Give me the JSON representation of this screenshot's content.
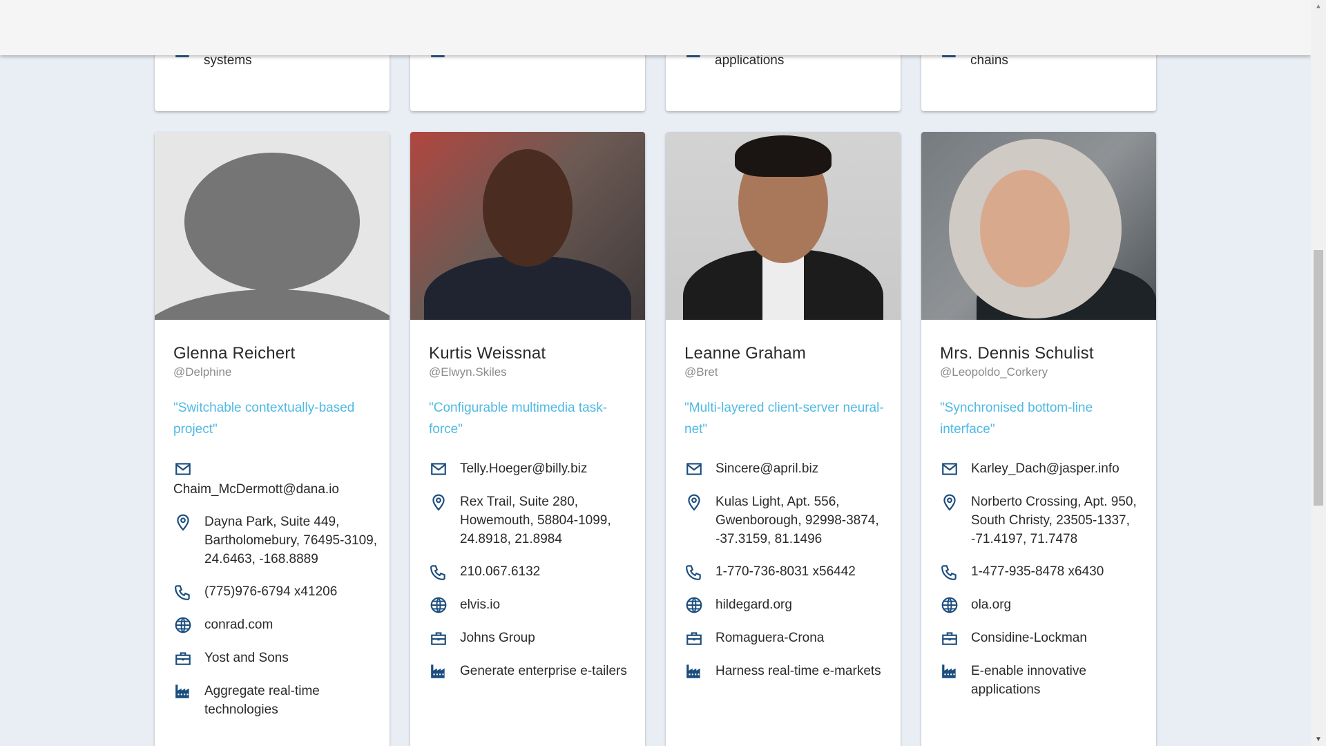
{
  "colors": {
    "accent_quote": "#4fb9e3",
    "icon": "#1b4d7e",
    "background": "#e9eef5"
  },
  "top_cards": [
    {
      "catch_phrase": "systems",
      "icon": "factory-icon"
    },
    {
      "catch_phrase": "",
      "icon": "factory-icon"
    },
    {
      "catch_phrase": "applications",
      "icon": "factory-icon"
    },
    {
      "catch_phrase": "chains",
      "icon": "factory-icon"
    }
  ],
  "users": [
    {
      "name": "Glenna Reichert",
      "username": "@Delphine",
      "quote": "\"Switchable contextually-based project\"",
      "email": "Chaim_McDermott@dana.io",
      "address": "Dayna Park, Suite 449, Bartholomebury, 76495-3109, 24.6463, -168.8889",
      "phone": "(775)976-6794 x41206",
      "website": "conrad.com",
      "company": "Yost and Sons",
      "bs": "Aggregate real-time technologies",
      "photo": "default-avatar"
    },
    {
      "name": "Kurtis Weissnat",
      "username": "@Elwyn.Skiles",
      "quote": "\"Configurable multimedia task-force\"",
      "email": "Telly.Hoeger@billy.biz",
      "address": "Rex Trail, Suite 280, Howemouth, 58804-1099, 24.8918, 21.8984",
      "phone": "210.067.6132",
      "website": "elvis.io",
      "company": "Johns Group",
      "bs": "Generate enterprise e-tailers",
      "photo": "portrait-photo"
    },
    {
      "name": "Leanne Graham",
      "username": "@Bret",
      "quote": "\"Multi-layered client-server neural-net\"",
      "email": "Sincere@april.biz",
      "address": "Kulas Light, Apt. 556, Gwenborough, 92998-3874, -37.3159, 81.1496",
      "phone": "1-770-736-8031 x56442",
      "website": "hildegard.org",
      "company": "Romaguera-Crona",
      "bs": "Harness real-time e-markets",
      "photo": "portrait-photo"
    },
    {
      "name": "Mrs. Dennis Schulist",
      "username": "@Leopoldo_Corkery",
      "quote": "\"Synchronised bottom-line interface\"",
      "email": "Karley_Dach@jasper.info",
      "address": "Norberto Crossing, Apt. 950, South Christy, 23505-1337, -71.4197, 71.7478",
      "phone": "1-477-935-8478 x6430",
      "website": "ola.org",
      "company": "Considine-Lockman",
      "bs": "E-enable innovative applications",
      "photo": "portrait-photo"
    }
  ]
}
